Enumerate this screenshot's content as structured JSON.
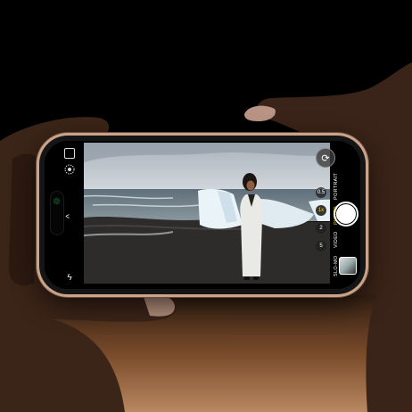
{
  "camera": {
    "zoom_levels": [
      "0.5",
      "1x",
      "2",
      "5"
    ],
    "active_zoom": "1x",
    "modes": [
      "PORTRAIT",
      "PHOTO",
      "VIDEO",
      "SLO-MO"
    ],
    "active_mode": "PHOTO",
    "side_controls": {
      "flash": "ϟ",
      "chevron": "^",
      "flip": "⟳"
    }
  },
  "colors": {
    "accent": "#ffd60a",
    "background_top": "#000000",
    "background_bottom": "#b98862"
  }
}
